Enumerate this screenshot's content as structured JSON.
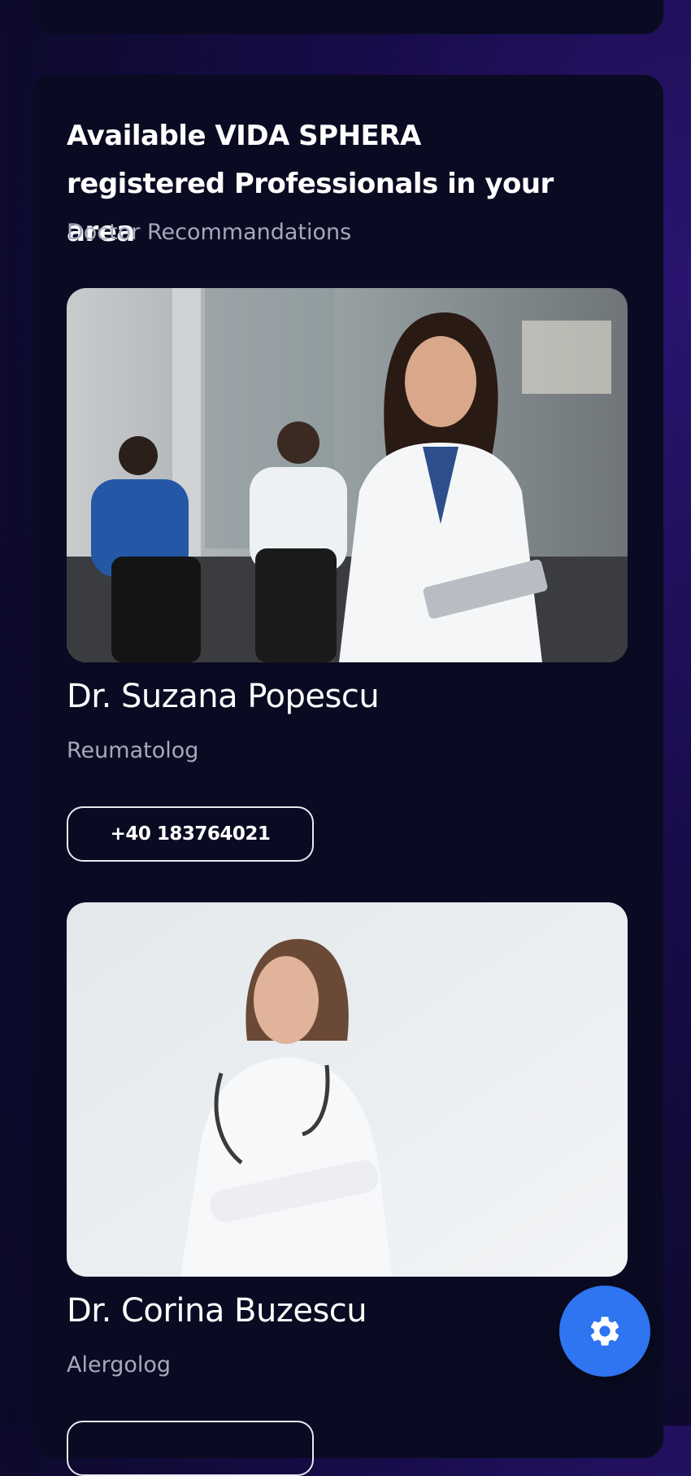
{
  "section": {
    "title": "Available VIDA SPHERA registered Professionals in your area",
    "subtitle": "Doctor Recommandations"
  },
  "doctors": [
    {
      "name": "Dr. Suzana Popescu",
      "specialty": "Reumatolog",
      "phone": "+40 183764021"
    },
    {
      "name": "Dr. Corina Buzescu",
      "specialty": "Alergolog",
      "phone": ""
    }
  ],
  "icons": {
    "settings": "gear-icon"
  },
  "colors": {
    "background": "#0d0a2e",
    "card": "#0a0b22",
    "accent": "#2f74f0",
    "text_primary": "#ffffff",
    "text_secondary": "#a7a8bd"
  }
}
